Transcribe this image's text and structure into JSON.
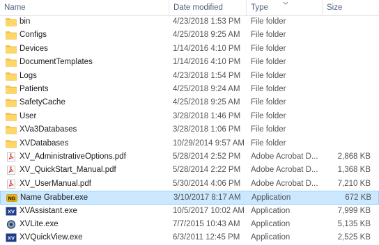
{
  "header": {
    "name": "Name",
    "date": "Date modified",
    "type": "Type",
    "size": "Size"
  },
  "files": [
    {
      "name": "bin",
      "date": "4/23/2018 1:53 PM",
      "type": "File folder",
      "size": "",
      "icon": "folder-icon"
    },
    {
      "name": "Configs",
      "date": "4/25/2018 9:25 AM",
      "type": "File folder",
      "size": "",
      "icon": "folder-icon"
    },
    {
      "name": "Devices",
      "date": "1/14/2016 4:10 PM",
      "type": "File folder",
      "size": "",
      "icon": "folder-icon"
    },
    {
      "name": "DocumentTemplates",
      "date": "1/14/2016 4:10 PM",
      "type": "File folder",
      "size": "",
      "icon": "folder-icon"
    },
    {
      "name": "Logs",
      "date": "4/23/2018 1:54 PM",
      "type": "File folder",
      "size": "",
      "icon": "folder-icon"
    },
    {
      "name": "Patients",
      "date": "4/25/2018 9:24 AM",
      "type": "File folder",
      "size": "",
      "icon": "folder-icon"
    },
    {
      "name": "SafetyCache",
      "date": "4/25/2018 9:25 AM",
      "type": "File folder",
      "size": "",
      "icon": "folder-icon"
    },
    {
      "name": "User",
      "date": "3/28/2018 1:46 PM",
      "type": "File folder",
      "size": "",
      "icon": "folder-icon"
    },
    {
      "name": "XVa3Databases",
      "date": "3/28/2018 1:06 PM",
      "type": "File folder",
      "size": "",
      "icon": "folder-icon"
    },
    {
      "name": "XVDatabases",
      "date": "10/29/2014 9:57 AM",
      "type": "File folder",
      "size": "",
      "icon": "folder-icon"
    },
    {
      "name": "XV_AdministrativeOptions.pdf",
      "date": "5/28/2014 2:52 PM",
      "type": "Adobe Acrobat D...",
      "size": "2,868 KB",
      "icon": "pdf-icon"
    },
    {
      "name": "XV_QuickStart_Manual.pdf",
      "date": "5/28/2014 2:22 PM",
      "type": "Adobe Acrobat D...",
      "size": "1,368 KB",
      "icon": "pdf-icon"
    },
    {
      "name": "XV_UserManual.pdf",
      "date": "5/30/2014 4:06 PM",
      "type": "Adobe Acrobat D...",
      "size": "7,210 KB",
      "icon": "pdf-icon"
    },
    {
      "name": "Name Grabber.exe",
      "date": "3/10/2017 8:17 AM",
      "type": "Application",
      "size": "672 KB",
      "icon": "name-grabber-icon",
      "selected": true
    },
    {
      "name": "XVAssistant.exe",
      "date": "10/5/2017 10:02 AM",
      "type": "Application",
      "size": "7,999 KB",
      "icon": "xv-app-icon"
    },
    {
      "name": "XVLite.exe",
      "date": "7/7/2015 10:43 AM",
      "type": "Application",
      "size": "5,135 KB",
      "icon": "xvlite-icon"
    },
    {
      "name": "XVQuickView.exe",
      "date": "6/3/2011 12:45 PM",
      "type": "Application",
      "size": "2,525 KB",
      "icon": "xv-app-icon"
    }
  ],
  "colors": {
    "folder": "#f4c54c",
    "pdf": "#d9302c",
    "selected": "#cce8ff",
    "app_blue": "#1e3a8a",
    "name_grabber": "#f0b400"
  }
}
